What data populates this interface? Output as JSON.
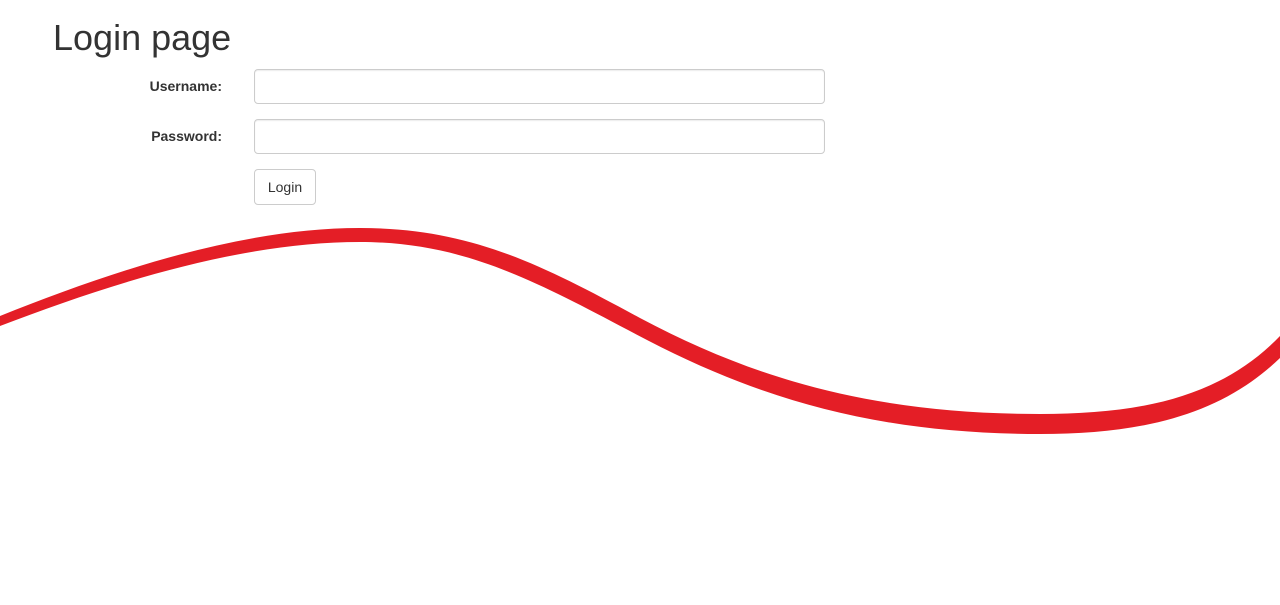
{
  "header": {
    "title": "Login page"
  },
  "form": {
    "username_label": "Username:",
    "username_value": "",
    "password_label": "Password:",
    "password_value": "",
    "login_label": "Login"
  },
  "colors": {
    "swoosh": "#e41e26",
    "text": "#333333",
    "border": "#cccccc"
  }
}
